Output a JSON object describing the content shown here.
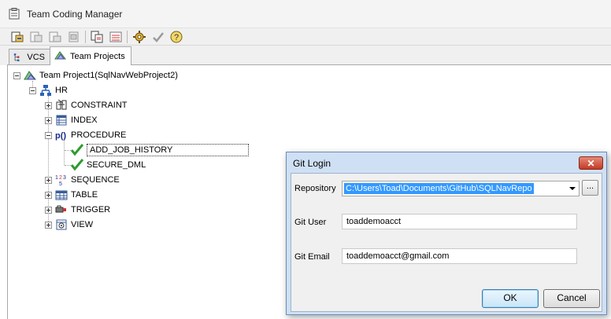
{
  "window": {
    "title": "Team Coding Manager"
  },
  "toolbar": {
    "buttons": [
      "check-in-icon",
      "check-out-icon",
      "undo-checkout-icon",
      "get-latest-icon",
      "compare-icon",
      "merge-icon",
      "settings-icon",
      "validate-icon",
      "help-icon"
    ]
  },
  "tabs": [
    {
      "label": "VCS",
      "icon": "vcs-icon",
      "active": false
    },
    {
      "label": "Team Projects",
      "icon": "team-projects-icon",
      "active": true
    }
  ],
  "tree": {
    "project": "Team Project1(SqlNavWebProject2)",
    "schema": "HR",
    "nodes": {
      "constraint": "CONSTRAINT",
      "index": "INDEX",
      "procedure": "PROCEDURE",
      "proc_items": [
        "ADD_JOB_HISTORY",
        "SECURE_DML"
      ],
      "sequence": "SEQUENCE",
      "table": "TABLE",
      "trigger": "TRIGGER",
      "view": "VIEW"
    }
  },
  "dialog": {
    "title": "Git Login",
    "close_glyph": "✕",
    "repository_label": "Repository",
    "repository_value": "C:\\Users\\Toad\\Documents\\GitHub\\SQLNavRepo",
    "browse_label": "...",
    "user_label": "Git User",
    "user_value": "toaddemoacct",
    "email_label": "Git Email",
    "email_value": "toaddemoacct@gmail.com",
    "ok_label": "OK",
    "cancel_label": "Cancel"
  },
  "colors": {
    "dialog_frame": "#cfe0f4",
    "selection": "#3399ff",
    "check_green": "#2e9b2e",
    "close_red": "#c43a24"
  }
}
